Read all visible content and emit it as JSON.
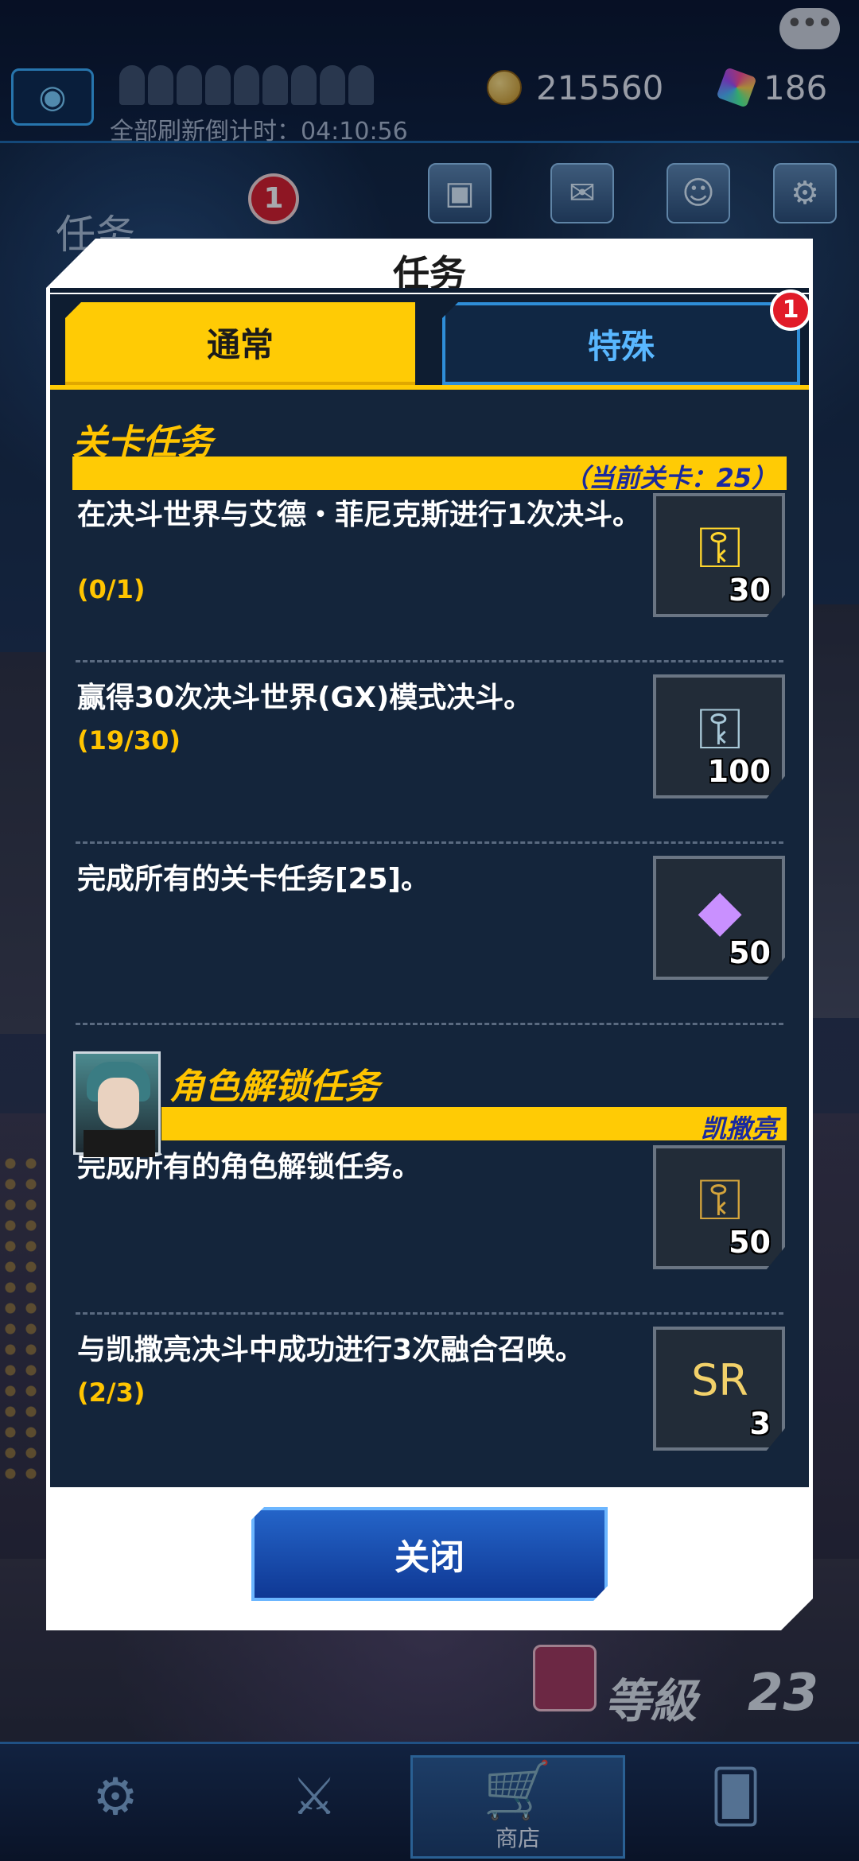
{
  "hud": {
    "refresh_countdown": "全部刷新倒计时：04:10:56",
    "coins": "215560",
    "gems": "186",
    "background_tab_label": "任务",
    "background_badge": "1",
    "level_label": "等級",
    "level_value": "23",
    "shop_label": "商店"
  },
  "modal": {
    "title": "任务",
    "tabs": [
      {
        "label": "通常",
        "active": true
      },
      {
        "label": "特殊",
        "active": false,
        "badge": "1"
      }
    ],
    "stage_section": {
      "title": "关卡任务",
      "subtitle": "（当前关卡：25）",
      "missions": [
        {
          "text": "在决斗世界与艾德・菲尼克斯进行1次决斗。",
          "progress": "(0/1)",
          "reward_icon": "gold-key-icon",
          "reward_count": "30"
        },
        {
          "text": "赢得30次决斗世界(GX)模式决斗。",
          "progress": "(19/30)",
          "reward_icon": "silver-key-icon",
          "reward_count": "100"
        },
        {
          "text": "完成所有的关卡任务[25]。",
          "progress": "",
          "reward_icon": "gem-icon",
          "reward_count": "50"
        }
      ]
    },
    "character_section": {
      "title": "角色解锁任务",
      "character_name": "凯撒亮",
      "missions": [
        {
          "text": "完成所有的角色解锁任务。",
          "progress": "",
          "reward_icon": "bronze-key-icon",
          "reward_count": "50"
        },
        {
          "text": "与凯撒亮决斗中成功进行3次融合召唤。",
          "progress": "(2/3)",
          "reward_icon": "sr-ticket-icon",
          "reward_count": "3"
        }
      ]
    },
    "close_label": "关闭"
  },
  "colors": {
    "accent_yellow": "#ffcb05",
    "panel_dark": "#14253b",
    "tab_inactive_text": "#59b7ff",
    "progress_text": "#ffc400",
    "close_button": "#1a4fb0"
  }
}
